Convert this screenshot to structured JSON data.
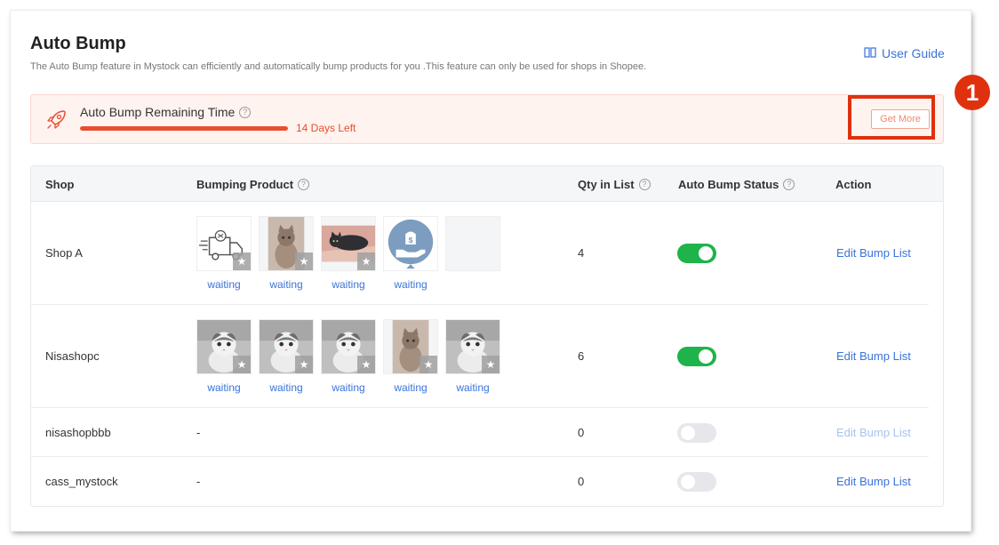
{
  "page": {
    "title": "Auto Bump",
    "description": "The Auto Bump feature in Mystock can efficiently and automatically bump products for you .This feature can only be used for shops in Shopee.",
    "user_guide": "User Guide"
  },
  "banner": {
    "label": "Auto Bump Remaining Time",
    "days_left": "14 Days Left",
    "get_more": "Get More",
    "remaining_fraction": 1.0
  },
  "callout": {
    "number": "1"
  },
  "table": {
    "headers": {
      "shop": "Shop",
      "bumping_product": "Bumping Product",
      "qty": "Qty in List",
      "status": "Auto Bump Status",
      "action": "Action"
    },
    "rows": [
      {
        "shop": "Shop A",
        "qty": "4",
        "status_on": true,
        "action": "Edit Bump List",
        "action_disabled": false,
        "no_products": "",
        "products": [
          {
            "image": "truck-icon",
            "label": "waiting"
          },
          {
            "image": "cat-photo",
            "label": "waiting"
          },
          {
            "image": "cat-lying-photo",
            "label": "waiting"
          },
          {
            "image": "money-hand-icon",
            "label": "waiting"
          }
        ]
      },
      {
        "shop": "Nisashopc",
        "qty": "6",
        "status_on": true,
        "action": "Edit Bump List",
        "action_disabled": false,
        "no_products": "",
        "products": [
          {
            "image": "kitten-photo",
            "label": "waiting"
          },
          {
            "image": "kitten-photo",
            "label": "waiting"
          },
          {
            "image": "kitten-photo",
            "label": "waiting"
          },
          {
            "image": "cat-photo",
            "label": "waiting"
          },
          {
            "image": "kitten-photo",
            "label": "waiting"
          }
        ]
      },
      {
        "shop": "nisashopbbb",
        "qty": "0",
        "status_on": false,
        "action": "Edit Bump List",
        "action_disabled": true,
        "no_products": "-",
        "products": []
      },
      {
        "shop": "cass_mystock",
        "qty": "0",
        "status_on": false,
        "action": "Edit Bump List",
        "action_disabled": false,
        "no_products": "-",
        "products": []
      }
    ]
  },
  "colors": {
    "accent": "#3a73d9",
    "alert": "#e84e2f",
    "toggle_on": "#1fb34b",
    "callout": "#e0310f"
  }
}
